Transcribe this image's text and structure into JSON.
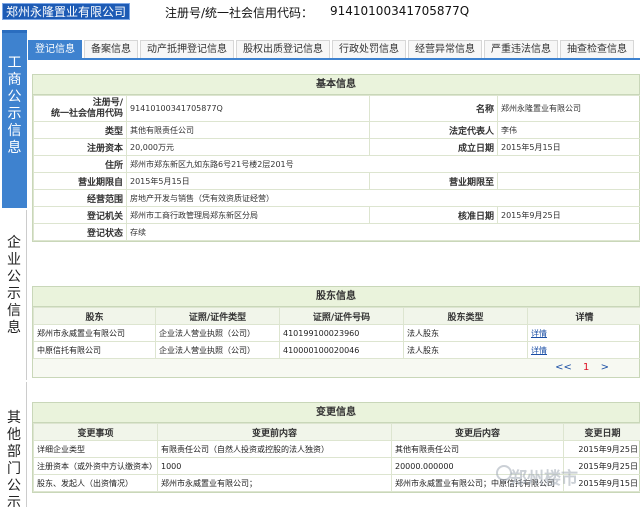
{
  "header": {
    "company": "郑州永隆置业有限公司",
    "reg_label": "注册号/统一社会信用代码：",
    "reg_value": "91410100341705877Q"
  },
  "leftnav": [
    {
      "label": "工商公示信息",
      "active": true
    },
    {
      "label": "企业公示信息",
      "active": false
    },
    {
      "label": "其他部门公示",
      "active": false
    }
  ],
  "tabs": [
    {
      "label": "登记信息",
      "active": true
    },
    {
      "label": "备案信息"
    },
    {
      "label": "动产抵押登记信息"
    },
    {
      "label": "股权出质登记信息"
    },
    {
      "label": "行政处罚信息"
    },
    {
      "label": "经营异常信息"
    },
    {
      "label": "严重违法信息"
    },
    {
      "label": "抽查检查信息"
    }
  ],
  "basic": {
    "title": "基本信息",
    "reg_no_label": "注册号/\n统一社会信用代码",
    "reg_no": "91410100341705877Q",
    "name_label": "名称",
    "name": "郑州永隆置业有限公司",
    "type_label": "类型",
    "type": "其他有限责任公司",
    "legal_label": "法定代表人",
    "legal": "李伟",
    "capital_label": "注册资本",
    "capital": "20,000万元",
    "founded_label": "成立日期",
    "founded": "2015年5月15日",
    "address_label": "住所",
    "address": "郑州市郑东新区九如东路6号21号楼2层201号",
    "from_label": "营业期限自",
    "from": "2015年5月15日",
    "to_label": "营业期限至",
    "to": "",
    "scope_label": "经营范围",
    "scope": "房地产开发与销售（凭有效资质证经营）",
    "authority_label": "登记机关",
    "authority": "郑州市工商行政管理局郑东新区分局",
    "approval_label": "核准日期",
    "approval": "2015年9月25日",
    "status_label": "登记状态",
    "status": "存续"
  },
  "shareholders": {
    "title": "股东信息",
    "headers": [
      "股东",
      "证照/证件类型",
      "证照/证件号码",
      "股东类型",
      "详情"
    ],
    "rows": [
      {
        "name": "郑州市永威置业有限公司",
        "id_type": "企业法人营业执照（公司）",
        "id_no": "410199100023960",
        "kind": "法人股东",
        "detail": "详情"
      },
      {
        "name": "中原信托有限公司",
        "id_type": "企业法人营业执照（公司）",
        "id_no": "410000100020046",
        "kind": "法人股东",
        "detail": "详情"
      }
    ],
    "pager_prev": "<<",
    "pager_page": "1",
    "pager_next": ">"
  },
  "changes": {
    "title": "变更信息",
    "headers": [
      "变更事项",
      "变更前内容",
      "变更后内容",
      "变更日期"
    ],
    "rows": [
      {
        "item": "详细企业类型",
        "before": "有限责任公司（自然人投资或控股的法人独资）",
        "after": "其他有限责任公司",
        "date": "2015年9月25日"
      },
      {
        "item": "注册资本（或外资中方认缴资本）",
        "before": "1000",
        "after": "20000.000000",
        "date": "2015年9月25日"
      },
      {
        "item": "股东、发起人（出资情况）",
        "before": "郑州市永威置业有限公司；",
        "after": "郑州市永威置业有限公司；中原信托有限公司",
        "date": "2015年9月15日"
      }
    ]
  },
  "watermark": "郑州楼市"
}
